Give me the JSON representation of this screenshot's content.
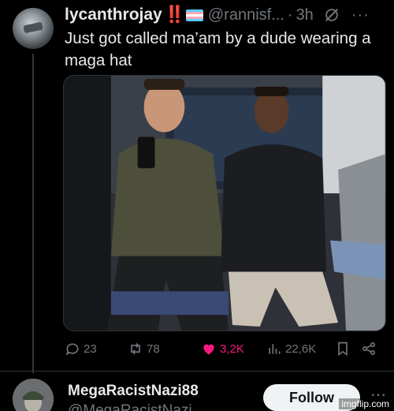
{
  "tweet": {
    "display_name": "lycanthrojay",
    "badge_emoji": "‼️",
    "flag_icon": "transgender-flag",
    "handle": "@rannisf...",
    "separator": "·",
    "time": "3h",
    "text": "Just got called ma’am by a dude wearing a maga hat",
    "media_alt": "Two men seated on a subway train; one in an olive jacket looking at a phone, one in a black puffer jacket"
  },
  "actions": {
    "replies": "23",
    "retweets": "78",
    "likes": "3,2K",
    "views": "22,6K"
  },
  "reply_user": {
    "display_name": "MegaRacistNazi88",
    "handle": "@MegaRacistNazi...",
    "follow_label": "Follow"
  },
  "watermark": "imgflip.com",
  "colors": {
    "background": "#000000",
    "text": "#e7e9ea",
    "muted": "#71767b",
    "like": "#f91880",
    "follow_bg": "#eff3f4"
  }
}
